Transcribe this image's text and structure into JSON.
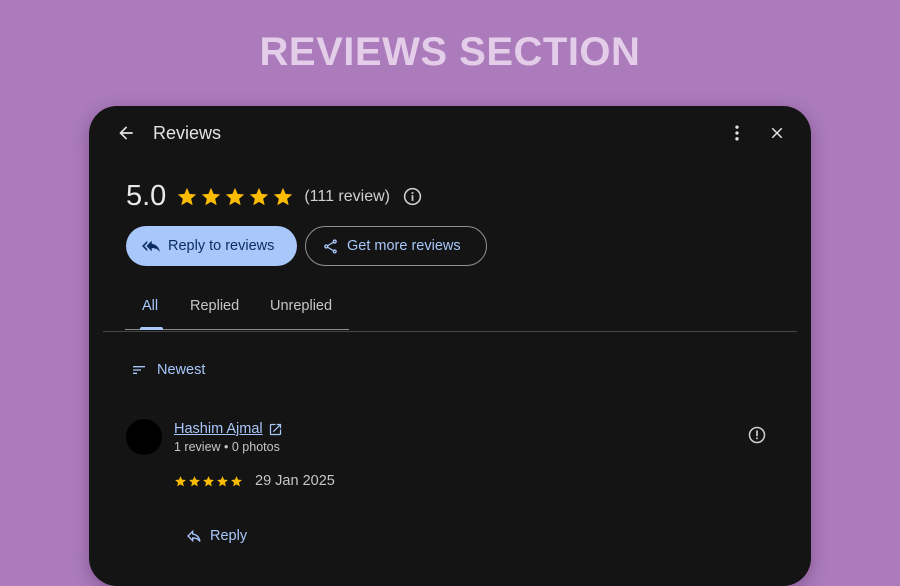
{
  "banner": {
    "title": "REVIEWS SECTION"
  },
  "header": {
    "title": "Reviews"
  },
  "summary": {
    "rating": "5.0",
    "stars": 5,
    "count_text": "(111 review)"
  },
  "actions": {
    "reply_label": "Reply to reviews",
    "get_more_label": "Get more reviews"
  },
  "tabs": [
    {
      "label": "All",
      "active": true
    },
    {
      "label": "Replied",
      "active": false
    },
    {
      "label": "Unreplied",
      "active": false
    }
  ],
  "sort": {
    "label": "Newest"
  },
  "reviews": [
    {
      "author": "Hashim Ajmal",
      "meta": "1 review • 0 photos",
      "rating": 5,
      "date": "29 Jan 2025",
      "reply_label": "Reply"
    }
  ],
  "colors": {
    "accent": "#a8c7fa",
    "star": "#fbbc04",
    "panel_bg": "#141414",
    "page_bg": "#ab7bbb"
  },
  "icons": [
    "arrow-left-icon",
    "more-vert-icon",
    "close-icon",
    "info-icon",
    "reply-icon",
    "share-icon",
    "sort-icon",
    "open-external-icon",
    "report-icon",
    "star-icon"
  ]
}
